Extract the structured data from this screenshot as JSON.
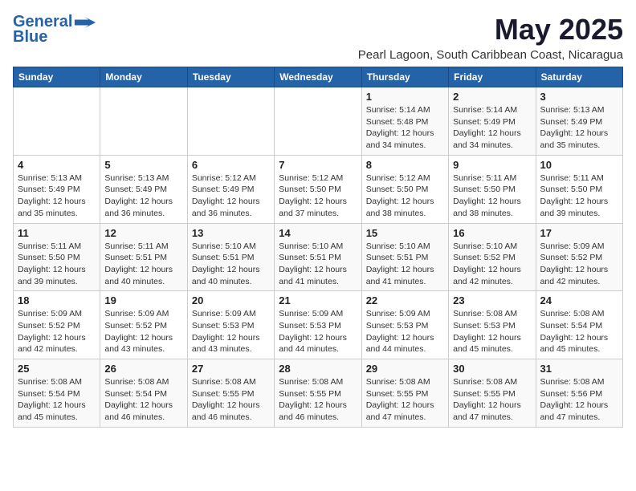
{
  "logo": {
    "line1": "General",
    "line2": "Blue"
  },
  "title": "May 2025",
  "subtitle": "Pearl Lagoon, South Caribbean Coast, Nicaragua",
  "weekdays": [
    "Sunday",
    "Monday",
    "Tuesday",
    "Wednesday",
    "Thursday",
    "Friday",
    "Saturday"
  ],
  "weeks": [
    [
      {
        "day": "",
        "info": ""
      },
      {
        "day": "",
        "info": ""
      },
      {
        "day": "",
        "info": ""
      },
      {
        "day": "",
        "info": ""
      },
      {
        "day": "1",
        "info": "Sunrise: 5:14 AM\nSunset: 5:48 PM\nDaylight: 12 hours\nand 34 minutes."
      },
      {
        "day": "2",
        "info": "Sunrise: 5:14 AM\nSunset: 5:49 PM\nDaylight: 12 hours\nand 34 minutes."
      },
      {
        "day": "3",
        "info": "Sunrise: 5:13 AM\nSunset: 5:49 PM\nDaylight: 12 hours\nand 35 minutes."
      }
    ],
    [
      {
        "day": "4",
        "info": "Sunrise: 5:13 AM\nSunset: 5:49 PM\nDaylight: 12 hours\nand 35 minutes."
      },
      {
        "day": "5",
        "info": "Sunrise: 5:13 AM\nSunset: 5:49 PM\nDaylight: 12 hours\nand 36 minutes."
      },
      {
        "day": "6",
        "info": "Sunrise: 5:12 AM\nSunset: 5:49 PM\nDaylight: 12 hours\nand 36 minutes."
      },
      {
        "day": "7",
        "info": "Sunrise: 5:12 AM\nSunset: 5:50 PM\nDaylight: 12 hours\nand 37 minutes."
      },
      {
        "day": "8",
        "info": "Sunrise: 5:12 AM\nSunset: 5:50 PM\nDaylight: 12 hours\nand 38 minutes."
      },
      {
        "day": "9",
        "info": "Sunrise: 5:11 AM\nSunset: 5:50 PM\nDaylight: 12 hours\nand 38 minutes."
      },
      {
        "day": "10",
        "info": "Sunrise: 5:11 AM\nSunset: 5:50 PM\nDaylight: 12 hours\nand 39 minutes."
      }
    ],
    [
      {
        "day": "11",
        "info": "Sunrise: 5:11 AM\nSunset: 5:50 PM\nDaylight: 12 hours\nand 39 minutes."
      },
      {
        "day": "12",
        "info": "Sunrise: 5:11 AM\nSunset: 5:51 PM\nDaylight: 12 hours\nand 40 minutes."
      },
      {
        "day": "13",
        "info": "Sunrise: 5:10 AM\nSunset: 5:51 PM\nDaylight: 12 hours\nand 40 minutes."
      },
      {
        "day": "14",
        "info": "Sunrise: 5:10 AM\nSunset: 5:51 PM\nDaylight: 12 hours\nand 41 minutes."
      },
      {
        "day": "15",
        "info": "Sunrise: 5:10 AM\nSunset: 5:51 PM\nDaylight: 12 hours\nand 41 minutes."
      },
      {
        "day": "16",
        "info": "Sunrise: 5:10 AM\nSunset: 5:52 PM\nDaylight: 12 hours\nand 42 minutes."
      },
      {
        "day": "17",
        "info": "Sunrise: 5:09 AM\nSunset: 5:52 PM\nDaylight: 12 hours\nand 42 minutes."
      }
    ],
    [
      {
        "day": "18",
        "info": "Sunrise: 5:09 AM\nSunset: 5:52 PM\nDaylight: 12 hours\nand 42 minutes."
      },
      {
        "day": "19",
        "info": "Sunrise: 5:09 AM\nSunset: 5:52 PM\nDaylight: 12 hours\nand 43 minutes."
      },
      {
        "day": "20",
        "info": "Sunrise: 5:09 AM\nSunset: 5:53 PM\nDaylight: 12 hours\nand 43 minutes."
      },
      {
        "day": "21",
        "info": "Sunrise: 5:09 AM\nSunset: 5:53 PM\nDaylight: 12 hours\nand 44 minutes."
      },
      {
        "day": "22",
        "info": "Sunrise: 5:09 AM\nSunset: 5:53 PM\nDaylight: 12 hours\nand 44 minutes."
      },
      {
        "day": "23",
        "info": "Sunrise: 5:08 AM\nSunset: 5:53 PM\nDaylight: 12 hours\nand 45 minutes."
      },
      {
        "day": "24",
        "info": "Sunrise: 5:08 AM\nSunset: 5:54 PM\nDaylight: 12 hours\nand 45 minutes."
      }
    ],
    [
      {
        "day": "25",
        "info": "Sunrise: 5:08 AM\nSunset: 5:54 PM\nDaylight: 12 hours\nand 45 minutes."
      },
      {
        "day": "26",
        "info": "Sunrise: 5:08 AM\nSunset: 5:54 PM\nDaylight: 12 hours\nand 46 minutes."
      },
      {
        "day": "27",
        "info": "Sunrise: 5:08 AM\nSunset: 5:55 PM\nDaylight: 12 hours\nand 46 minutes."
      },
      {
        "day": "28",
        "info": "Sunrise: 5:08 AM\nSunset: 5:55 PM\nDaylight: 12 hours\nand 46 minutes."
      },
      {
        "day": "29",
        "info": "Sunrise: 5:08 AM\nSunset: 5:55 PM\nDaylight: 12 hours\nand 47 minutes."
      },
      {
        "day": "30",
        "info": "Sunrise: 5:08 AM\nSunset: 5:55 PM\nDaylight: 12 hours\nand 47 minutes."
      },
      {
        "day": "31",
        "info": "Sunrise: 5:08 AM\nSunset: 5:56 PM\nDaylight: 12 hours\nand 47 minutes."
      }
    ]
  ]
}
